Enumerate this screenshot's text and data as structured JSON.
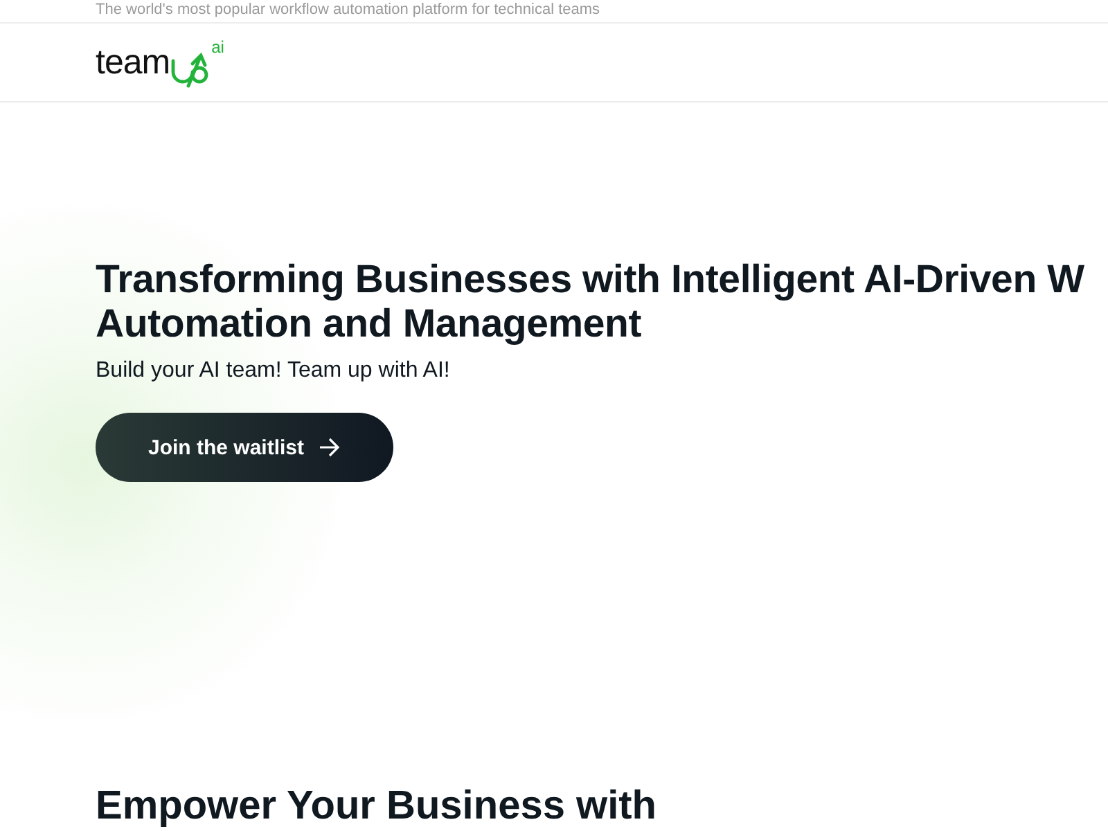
{
  "tagline": "The world's most popular workflow automation platform for technical teams",
  "logo": {
    "text": "team",
    "suffix": "ai"
  },
  "hero": {
    "title_lines": [
      "Transforming Businesses with Intelligent AI-Driven W",
      "Automation and Management"
    ],
    "subtitle": "Build your AI team! Team up with AI!",
    "button": "Join the waitlist"
  },
  "section": {
    "title": "Empower Your Business with"
  }
}
